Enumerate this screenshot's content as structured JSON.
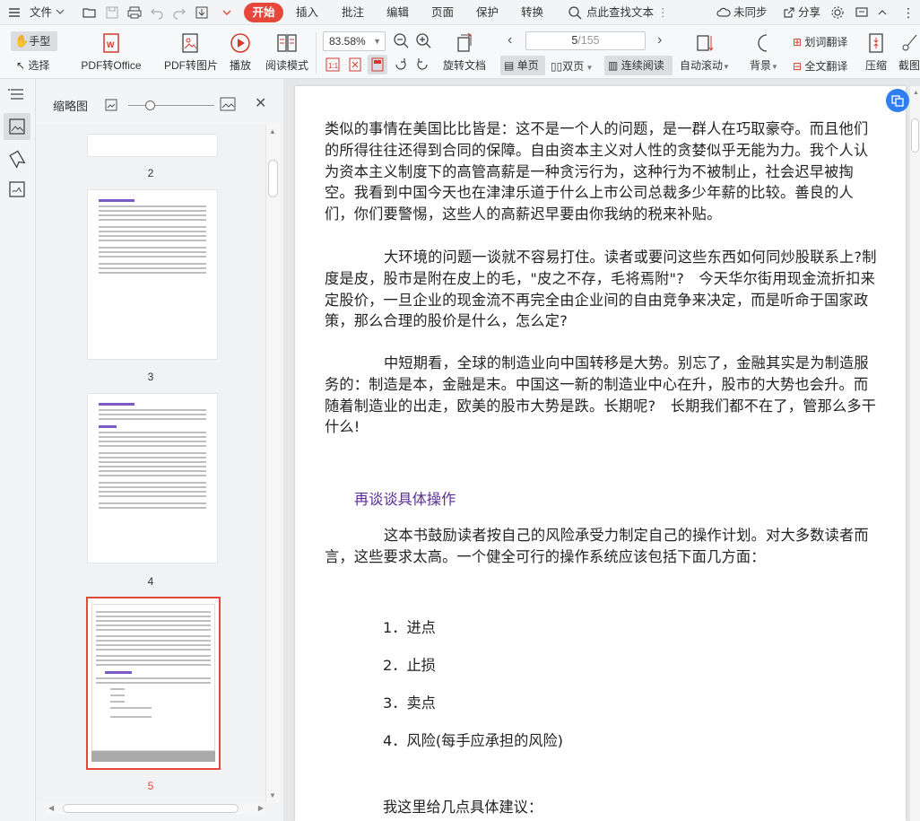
{
  "menubar": {
    "file": "文件",
    "start": "开始",
    "tabs": [
      "插入",
      "批注",
      "编辑",
      "页面",
      "保护",
      "转换"
    ],
    "search": "点此查找文本",
    "sync": "未同步",
    "share": "分享"
  },
  "toolbar": {
    "hand": "手型",
    "select": "选择",
    "pdf_office": "PDF转Office",
    "pdf_image": "PDF转图片",
    "play": "播放",
    "read_mode": "阅读模式",
    "zoom": "83.58%",
    "page_current": "5",
    "page_total": "/155",
    "rotate": "旋转文档",
    "single": "单页",
    "double": "双页",
    "continuous": "连续阅读",
    "autoscroll": "自动滚动",
    "background": "背景",
    "word_translate": "划词翻译",
    "full_translate": "全文翻译",
    "compress": "压缩",
    "crop": "截图"
  },
  "thumbnails": {
    "title": "缩略图",
    "pages": [
      {
        "num": "2"
      },
      {
        "num": "3"
      },
      {
        "num": "4"
      },
      {
        "num": "5"
      }
    ]
  },
  "document": {
    "p1": "类似的事情在美国比比皆是：这不是一个人的问题，是一群人在巧取豪夺。而且他们的所得往往还得到合同的保障。自由资本主义对人性的贪婪似乎无能为力。我个人认为资本主义制度下的高管高薪是一种贪污行为，这种行为不被制止，社会迟早被掏空。我看到中国今天也在津津乐道于什么上市公司总裁多少年薪的比较。善良的人们，你们要警惕，这些人的高薪迟早要由你我纳的税来补贴。",
    "p2": "大环境的问题一谈就不容易打住。读者或要问这些东西如何同炒股联系上?制度是皮，股市是附在皮上的毛，\"皮之不存，毛将焉附\"?　今天华尔街用现金流折扣来定股价，一旦企业的现金流不再完全由企业间的自由竞争来决定，而是听命于国家政策，那么合理的股价是什么，怎么定?",
    "p3": "中短期看，全球的制造业向中国转移是大势。别忘了，金融其实是为制造服务的：制造是本，金融是末。中国这一新的制造业中心在升，股市的大势也会升。而随着制造业的出走，欧美的股市大势是跌。长期呢?　长期我们都不在了，管那么多干什么!",
    "section_title": "再谈谈具体操作",
    "p4": "这本书鼓励读者按自己的风险承受力制定自己的操作计划。对大多数读者而言，这些要求太高。一个健全可行的操作系统应该包括下面几方面：",
    "list": [
      "1．进点",
      "2．止损",
      "3．卖点",
      "4．风险(每手应承担的风险)"
    ],
    "p5": "我这里给几点具体建议："
  }
}
